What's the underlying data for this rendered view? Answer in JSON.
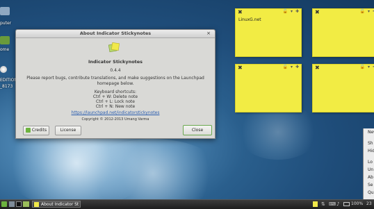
{
  "desktop": {
    "icons": [
      "puter",
      "ome",
      "EDITION",
      "_8173"
    ]
  },
  "notes": [
    {
      "text": "LinuxG.net"
    },
    {
      "text": ""
    },
    {
      "text": ""
    },
    {
      "text": ""
    }
  ],
  "dialog": {
    "title": "About Indicator Stickynotes",
    "close_glyph": "×",
    "app_name": "Indicator Stickynotes",
    "version": "0.4.4",
    "message": "Please report bugs, contribute translations, and make suggestions on the Launchpad homepage below.",
    "shortcuts_heading": "Keyboard shortcuts:",
    "shortcuts": [
      "Ctrl + W:  Delete note",
      "Ctrl + L:  Lock note",
      "Ctrl + N:  New note"
    ],
    "link": "https://launchpad.net/indicatorstickynotes",
    "copyright": "Copyright © 2012-2013 Umang Varma",
    "credits_label": "Credits",
    "license_label": "License",
    "close_label": "Close"
  },
  "context_menu": [
    "New",
    "Sh",
    "Hid",
    "Lo",
    "Un",
    "Ab",
    "Se",
    "Qu"
  ],
  "taskbar": {
    "window_label": "About Indicator St",
    "battery": "100%",
    "time": "23"
  },
  "colors": {
    "note": "#f2ec44",
    "panel": "#2a2a2a",
    "accent": "#6db33f"
  }
}
